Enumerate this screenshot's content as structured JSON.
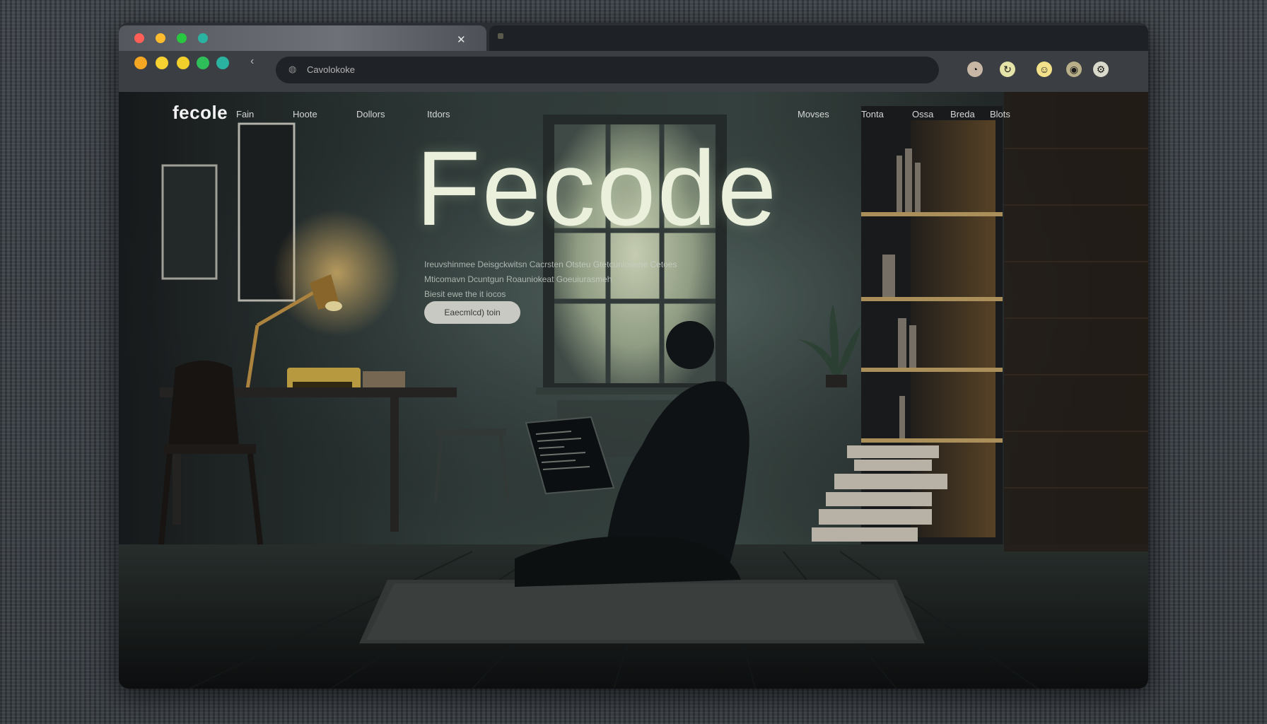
{
  "browser": {
    "tab_close_glyph": "✕",
    "url": "Cavolokoke",
    "tab_dots": [
      "#ff5f57",
      "#febc2e",
      "#28c840",
      "#2ab3a0"
    ],
    "toolbar_dots": [
      "#f5a623",
      "#f7d032",
      "#f3cf2b",
      "#2fbf5a",
      "#2ab3a0"
    ],
    "toolbar_icons": [
      "user-icon",
      "refresh-icon",
      "emoji-icon",
      "location-icon",
      "settings-icon"
    ]
  },
  "site": {
    "logo": "fecole",
    "nav_left": [
      "Fain",
      "Hoote",
      "Dollors",
      "Itdors"
    ],
    "nav_right": [
      "Movses",
      "Tonta",
      "Ossa",
      "Breda",
      "Blots"
    ],
    "hero": {
      "title": "Fecode",
      "line1": "Ireuvshinmee Deisgckwitsn Cacrsten Otsteu Gtetcuniosene Cetoes",
      "line2": "Mticomavn Dcuntgun Roauniokeat Goeuiurasmeh",
      "line3": "Biesit ewe the it iocos",
      "button": "Eaecmlcd) toin"
    }
  }
}
